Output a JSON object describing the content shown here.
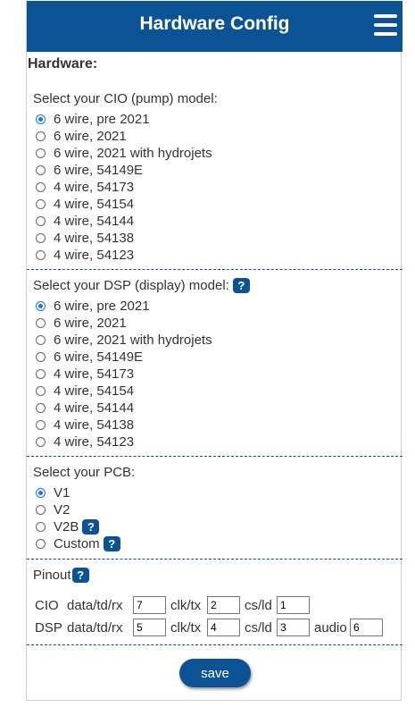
{
  "header": {
    "title": "Hardware Config",
    "menu_icon": "hamburger-menu-icon"
  },
  "section_title": "Hardware:",
  "cio": {
    "label": "Select your CIO (pump) model:",
    "selected": 0,
    "options": [
      "6 wire, pre 2021",
      "6 wire, 2021",
      "6 wire, 2021 with hydrojets",
      "6 wire, 54149E",
      "4 wire, 54173",
      "4 wire, 54154",
      "4 wire, 54144",
      "4 wire, 54138",
      "4 wire, 54123"
    ]
  },
  "dsp": {
    "label": "Select your DSP (display) model:",
    "help": "?",
    "selected": 0,
    "options": [
      "6 wire, pre 2021",
      "6 wire, 2021",
      "6 wire, 2021 with hydrojets",
      "6 wire, 54149E",
      "4 wire, 54173",
      "4 wire, 54154",
      "4 wire, 54144",
      "4 wire, 54138",
      "4 wire, 54123"
    ]
  },
  "pcb": {
    "label": "Select your PCB:",
    "selected": 0,
    "options": [
      "V1",
      "V2",
      "V2B",
      "Custom"
    ],
    "help": "?"
  },
  "pinout": {
    "label": "Pinout",
    "help": "?",
    "cio": {
      "name": "CIO",
      "data_label": "data/td/rx",
      "data": "7",
      "clk_label": "clk/tx",
      "clk": "2",
      "cs_label": "cs/ld",
      "cs": "1"
    },
    "dsp": {
      "name": "DSP",
      "data_label": "data/td/rx",
      "data": "5",
      "clk_label": "clk/tx",
      "clk": "4",
      "cs_label": "cs/ld",
      "cs": "3",
      "audio_label": "audio",
      "audio": "6"
    }
  },
  "save_label": "save",
  "colors": {
    "header_bg": "#0b5394",
    "radio_selected": "#1a73e8"
  }
}
